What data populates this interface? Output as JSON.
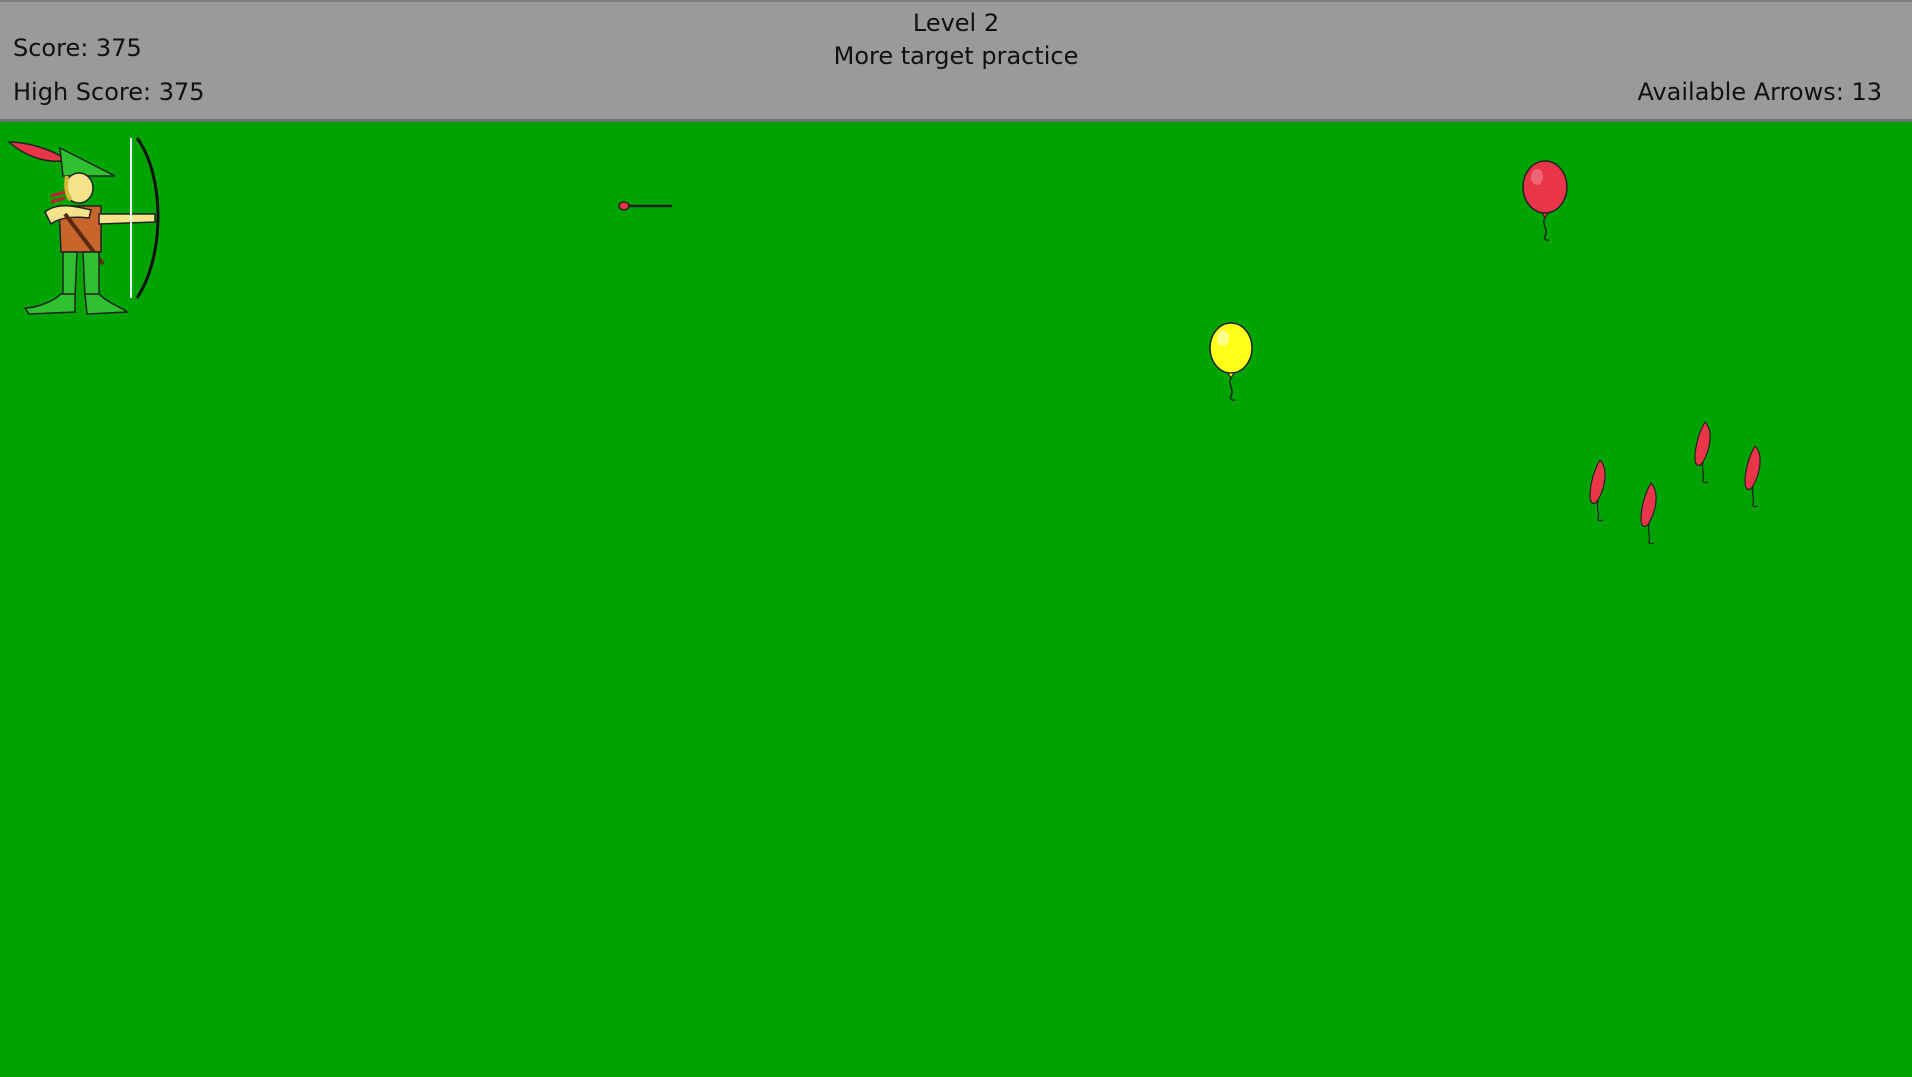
{
  "hud": {
    "score_text": "Score: 375",
    "high_score_text": "High Score: 375",
    "level_text": "Level 2",
    "level_subtitle": "More target practice",
    "arrows_text": "Available Arrows: 13"
  },
  "game": {
    "score": 375,
    "high_score": 375,
    "level": 2,
    "available_arrows": 13,
    "balloons": [
      {
        "color": "red",
        "state": "intact"
      },
      {
        "color": "yellow",
        "state": "intact"
      },
      {
        "color": "red",
        "state": "popped"
      },
      {
        "color": "red",
        "state": "popped"
      },
      {
        "color": "red",
        "state": "popped"
      },
      {
        "color": "red",
        "state": "popped"
      }
    ]
  },
  "colors": {
    "field": "#00a400",
    "hud_background": "#9a9a9a",
    "balloon_red": "#e8354a",
    "balloon_yellow": "#ffff1a"
  }
}
